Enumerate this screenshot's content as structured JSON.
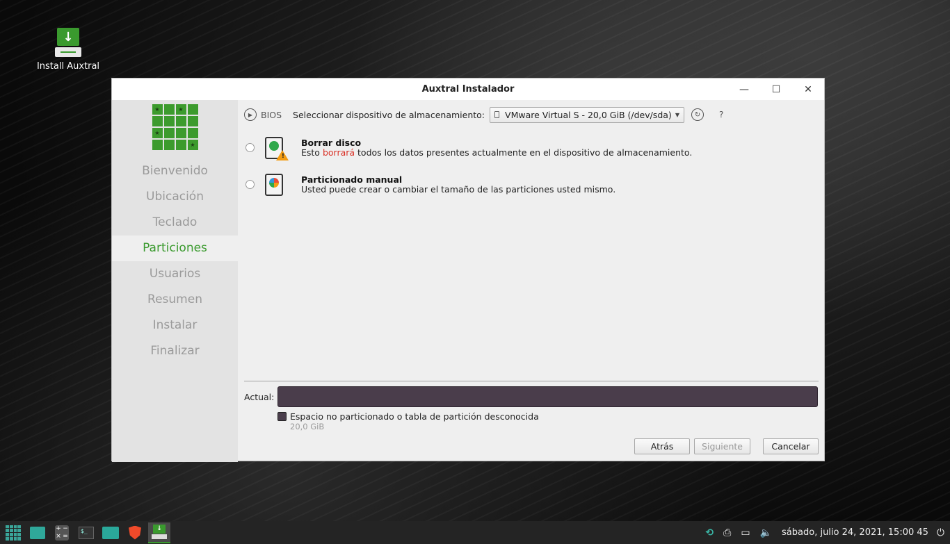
{
  "desktop": {
    "icon_label": "Install Auxtral"
  },
  "window": {
    "title": "Auxtral Instalador",
    "minimize": "—",
    "maximize": "☐",
    "close": "✕"
  },
  "sidebar": {
    "steps": [
      {
        "label": "Bienvenido"
      },
      {
        "label": "Ubicación"
      },
      {
        "label": "Teclado"
      },
      {
        "label": "Particiones"
      },
      {
        "label": "Usuarios"
      },
      {
        "label": "Resumen"
      },
      {
        "label": "Instalar"
      },
      {
        "label": "Finalizar"
      }
    ],
    "active_step": "Particiones"
  },
  "partition": {
    "bios_label": "BIOS",
    "device_label": "Seleccionar dispositivo de almacenamiento:",
    "device_value": "VMware Virtual S - 20,0 GiB (/dev/sda)",
    "help": "?",
    "options": [
      {
        "title": "Borrar disco",
        "desc_before": "Esto ",
        "desc_danger": "borrará",
        "desc_after": " todos los datos presentes actualmente en el dispositivo de almacenamiento."
      },
      {
        "title": "Particionado manual",
        "desc": "Usted puede crear o cambiar el tamaño de las particiones usted mismo."
      }
    ],
    "actual_label": "Actual:",
    "legend_text": "Espacio no particionado o tabla de partición desconocida",
    "legend_size": "20,0 GiB",
    "bar_color": "#4a3d4b",
    "danger_color": "#d93025",
    "accent_color": "#3a9a2e"
  },
  "buttons": {
    "back": "Atrás",
    "next": "Siguiente",
    "cancel": "Cancelar"
  },
  "taskbar": {
    "clock": "sábado, julio 24, 2021, 15:00 45"
  }
}
